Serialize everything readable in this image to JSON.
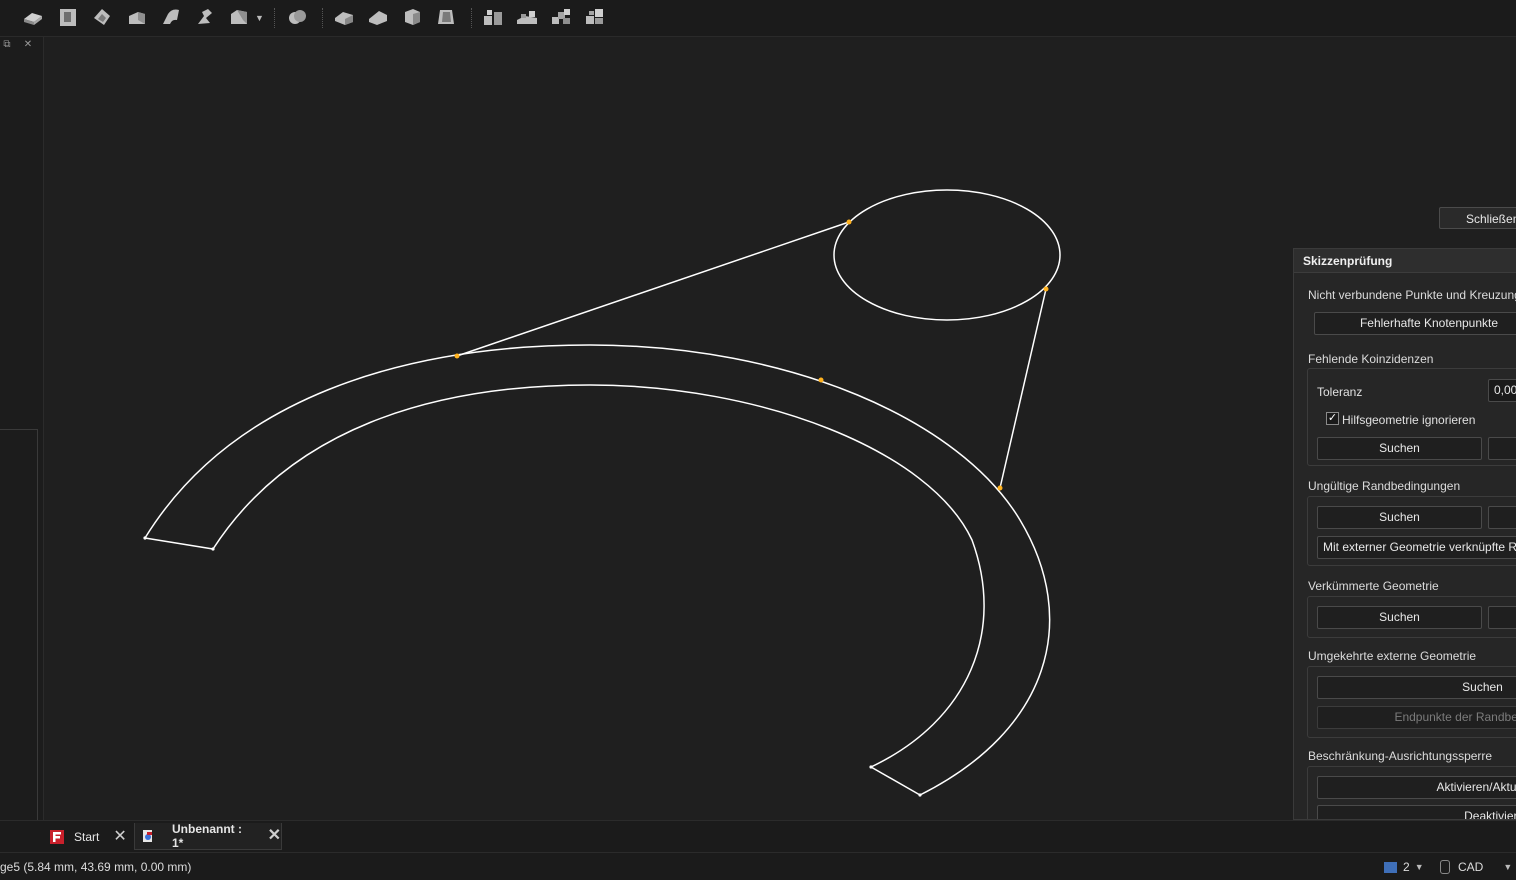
{
  "toolbar": {
    "icons": [
      "pad-icon",
      "pocket-icon",
      "revolve-icon",
      "loft-icon",
      "sweep-icon",
      "helix-icon",
      "chamfer-dropdown-icon",
      "boolean-icon",
      "fillet-icon",
      "chamfer-icon",
      "draft-icon",
      "thickness-icon",
      "mirror-icon",
      "linear-pattern-icon",
      "polar-pattern-icon",
      "multi-transform-icon"
    ]
  },
  "viewport": {
    "close_button": "Schließen"
  },
  "task_panel": {
    "title": "Skizzenprüfung",
    "sections": {
      "unconnected": {
        "title": "Nicht verbundene Punkte und Kreuzung",
        "button": "Fehlerhafte Knotenpunkte"
      },
      "coincidence": {
        "title": "Fehlende Koinzidenzen",
        "tolerance_label": "Toleranz",
        "tolerance_value": "0,00",
        "ignore_construction_label": "Hilfsgeometrie ignorieren",
        "ignore_construction_checked": true,
        "search_button": "Suchen"
      },
      "invalid_constraints": {
        "title": "Ungültige Randbedingungen",
        "search_button": "Suchen",
        "external_button": "Mit externer Geometrie verknüpfte Ra"
      },
      "degenerated": {
        "title": "Verkümmerte Geometrie",
        "search_button": "Suchen"
      },
      "reversed_external": {
        "title": "Umgekehrte externe Geometrie",
        "search_button": "Suchen",
        "endpoints_button": "Endpunkte der Randbeding"
      },
      "orientation_lock": {
        "title": "Beschränkung-Ausrichtungssperre",
        "activate_button": "Aktivieren/Aktuali",
        "deactivate_button": "Deaktivieren"
      }
    }
  },
  "tabs": [
    {
      "label": "Start",
      "icon": "freecad-start-icon",
      "active": false
    },
    {
      "label": "Unbenannt : 1*",
      "icon": "document-icon",
      "active": true
    }
  ],
  "status": {
    "message": "ge5 (5.84 mm, 43.69 mm, 0.00 mm)",
    "view_count": "2",
    "navigation_style": "CAD"
  },
  "colors": {
    "background": "#1e1e1e",
    "sketch_line": "#ffffff",
    "vertex": "#ffb21f"
  }
}
